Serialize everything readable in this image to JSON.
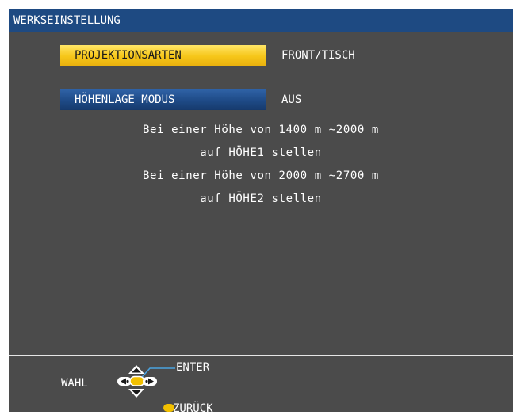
{
  "window": {
    "title": "WERKSEINSTELLUNG"
  },
  "menu": {
    "items": [
      {
        "label": "PROJEKTIONSARTEN",
        "value": "FRONT/TISCH",
        "selected": true
      },
      {
        "label": "HÖHENLAGE MODUS",
        "value": "AUS",
        "selected": false
      }
    ]
  },
  "info": {
    "lines": [
      "Bei einer Höhe von 1400 m ~2000 m",
      "auf HÖHE1 stellen",
      "Bei einer Höhe von 2000 m ~2700 m",
      "auf HÖHE2 stellen"
    ]
  },
  "footer": {
    "select_label": "WAHL",
    "enter_label": "ENTER",
    "back_label": "ZURÜCK"
  },
  "colors": {
    "title_bar": "#1e4a82",
    "panel": "#4b4b4b",
    "highlight": "#f6c619",
    "item_normal": "#1e4a86",
    "button_yellow": "#f2c000",
    "connector_line": "#4aa3e0"
  },
  "icons": {
    "up": "triangle-up-icon",
    "down": "triangle-down-icon",
    "left": "left-arrow-button-icon",
    "right": "right-arrow-button-icon",
    "enter": "enter-button-icon",
    "back": "back-button-icon"
  }
}
